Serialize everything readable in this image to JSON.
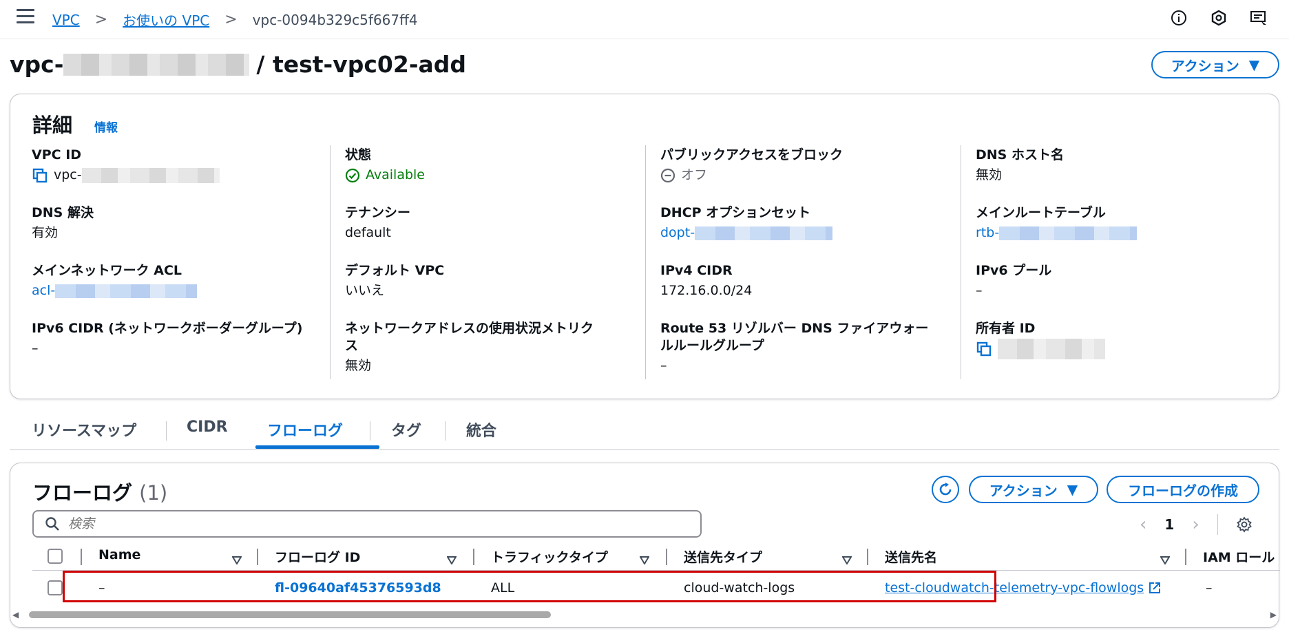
{
  "breadcrumb": {
    "vpc": "VPC",
    "your_vpcs": "お使いの VPC",
    "current": "vpc-0094b329c5f667ff4"
  },
  "title": {
    "prefix": "vpc-",
    "suffix": "/ test-vpc02-add"
  },
  "actions_label": "アクション",
  "details": {
    "heading": "詳細",
    "info": "情報",
    "fields": {
      "vpc_id": {
        "label": "VPC ID",
        "value": "vpc-"
      },
      "state": {
        "label": "状態",
        "value": "Available"
      },
      "block_public": {
        "label": "パブリックアクセスをブロック",
        "value": "オフ"
      },
      "dns_hostnames": {
        "label": "DNS ホスト名",
        "value": "無効"
      },
      "dns_resolution": {
        "label": "DNS 解決",
        "value": "有効"
      },
      "tenancy": {
        "label": "テナンシー",
        "value": "default"
      },
      "dhcp": {
        "label": "DHCP オプションセット",
        "value": "dopt-"
      },
      "main_rt": {
        "label": "メインルートテーブル",
        "value": "rtb-"
      },
      "main_acl": {
        "label": "メインネットワーク ACL",
        "value": "acl-"
      },
      "default_vpc": {
        "label": "デフォルト VPC",
        "value": "いいえ"
      },
      "ipv4": {
        "label": "IPv4 CIDR",
        "value": "172.16.0.0/24"
      },
      "ipv6pool": {
        "label": "IPv6 プール",
        "value": "–"
      },
      "ipv6cidr": {
        "label": "IPv6 CIDR (ネットワークボーダーグループ)",
        "value": "–"
      },
      "metrics": {
        "label1": "ネットワークアドレスの使用状況メトリク",
        "label2": "ス",
        "value": "無効"
      },
      "route53": {
        "label1": "Route 53 リゾルバー DNS ファイアウォー",
        "label2": "ルルールグループ",
        "value": "–"
      },
      "owner": {
        "label": "所有者 ID"
      }
    }
  },
  "tabs": [
    "リソースマップ",
    "CIDR",
    "フローログ",
    "タグ",
    "統合"
  ],
  "flowlogs": {
    "heading": "フローログ",
    "count": "(1)",
    "actions": "アクション",
    "create": "フローログの作成",
    "search_placeholder": "検索",
    "page": "1",
    "columns": [
      "Name",
      "フローログ ID",
      "トラフィックタイプ",
      "送信先タイプ",
      "送信先名",
      "IAM ロール"
    ],
    "row": {
      "name": "–",
      "id": "fl-09640af45376593d8",
      "traffic": "ALL",
      "dest_type": "cloud-watch-logs",
      "dest_name": "test-cloudwatch-telemetry-vpc-flowlogs",
      "iam": "–"
    }
  },
  "colors": {
    "link": "#0972d3",
    "available": "#037f0c",
    "highlight": "#d10000"
  }
}
